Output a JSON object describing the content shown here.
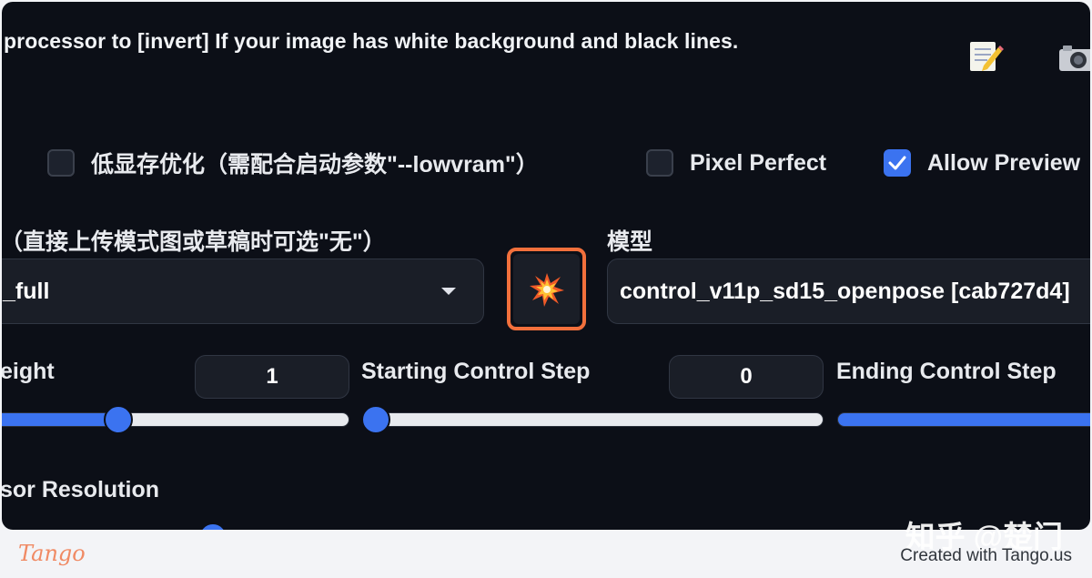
{
  "hint_text": "processor to [invert] If your image has white background and black lines.",
  "checkboxes": [
    {
      "label": "低显存优化（需配合启动参数\"--lowvram\"）",
      "checked": false
    },
    {
      "label": "Pixel Perfect",
      "checked": false
    },
    {
      "label": "Allow Preview",
      "checked": true
    }
  ],
  "preprocessor": {
    "label": "（直接上传模式图或草稿时可选\"无\"）",
    "value": "_full"
  },
  "run_button_icon": "💥",
  "model": {
    "label": "模型",
    "value": "control_v11p_sd15_openpose [cab727d4]"
  },
  "control_weight": {
    "label": "eight",
    "value": "1",
    "slider_fraction": 0.35
  },
  "starting_step": {
    "label": "Starting Control Step",
    "value": "0",
    "slider_fraction": 0.0
  },
  "ending_step": {
    "label": "Ending Control Step",
    "slider_fraction": 1.0
  },
  "resolution": {
    "label": "sor Resolution"
  },
  "watermark": "知乎 @楚门",
  "footer": {
    "logo": "Tango",
    "credit": "Created with Tango.us"
  },
  "colors": {
    "accent": "#3b73f0",
    "highlight": "#f2703c",
    "panel": "#0c0f17"
  }
}
